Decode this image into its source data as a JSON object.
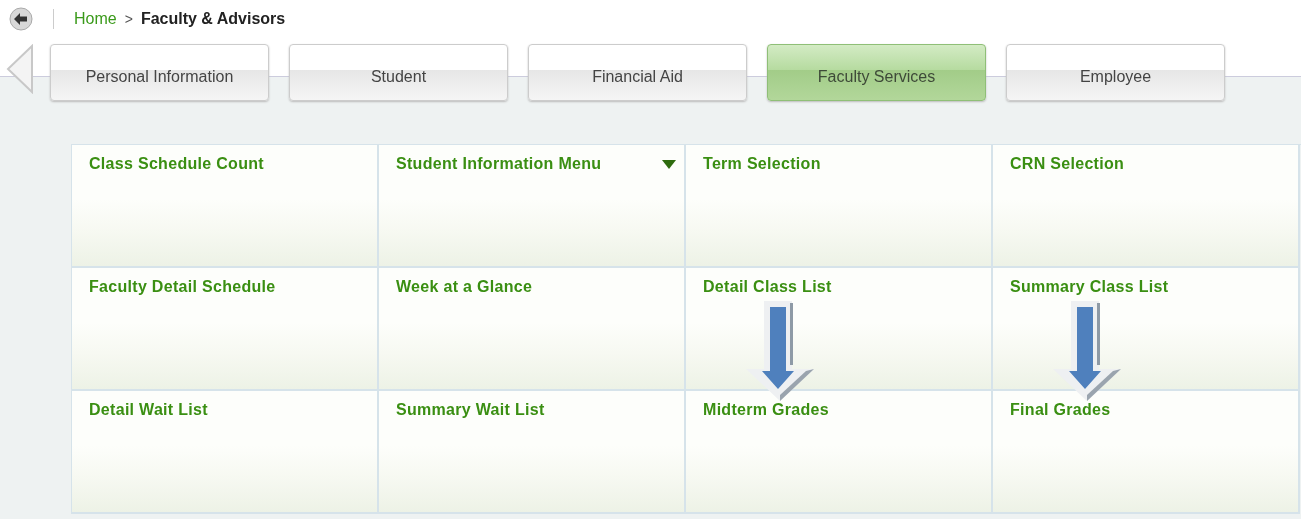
{
  "breadcrumb": {
    "home": "Home",
    "separator": ">",
    "current": "Faculty & Advisors"
  },
  "tabs": [
    {
      "label": "Personal Information",
      "selected": false
    },
    {
      "label": "Student",
      "selected": false
    },
    {
      "label": "Financial Aid",
      "selected": false
    },
    {
      "label": "Faculty Services",
      "selected": true
    },
    {
      "label": "Employee",
      "selected": false
    }
  ],
  "menu_cells": [
    {
      "label": "Class Schedule Count",
      "has_menu": false,
      "arrow": false
    },
    {
      "label": "Student Information Menu",
      "has_menu": true,
      "arrow": false
    },
    {
      "label": "Term Selection",
      "has_menu": false,
      "arrow": false
    },
    {
      "label": "CRN Selection",
      "has_menu": false,
      "arrow": false
    },
    {
      "label": "Faculty Detail Schedule",
      "has_menu": false,
      "arrow": false
    },
    {
      "label": "Week at a Glance",
      "has_menu": false,
      "arrow": false
    },
    {
      "label": "Detail Class List",
      "has_menu": false,
      "arrow": true
    },
    {
      "label": "Summary Class List",
      "has_menu": false,
      "arrow": true
    },
    {
      "label": "Detail Wait List",
      "has_menu": false,
      "arrow": false
    },
    {
      "label": "Summary Wait List",
      "has_menu": false,
      "arrow": false
    },
    {
      "label": "Midterm Grades",
      "has_menu": false,
      "arrow": false
    },
    {
      "label": "Final Grades",
      "has_menu": false,
      "arrow": false
    }
  ]
}
